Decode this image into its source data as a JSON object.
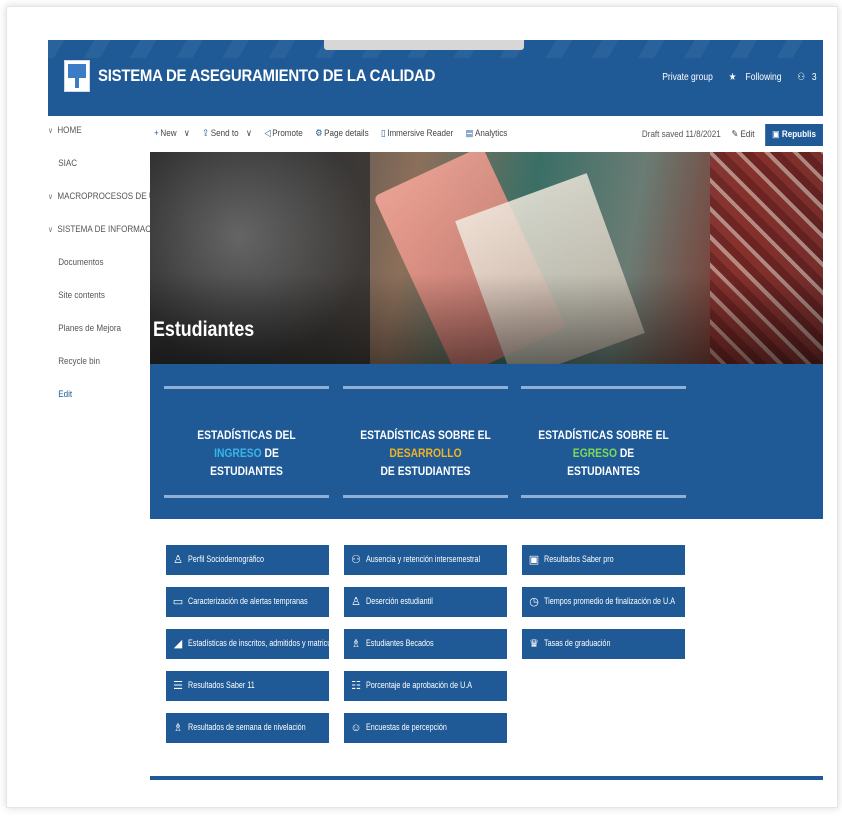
{
  "header": {
    "site_title": "SISTEMA DE ASEGURAMIENTO DE LA CALIDAD",
    "private_group": "Private group",
    "following": "Following",
    "members": "3"
  },
  "nav": {
    "items": [
      {
        "label": "HOME",
        "expandable": true
      },
      {
        "label": "SIAC",
        "expandable": false
      },
      {
        "label": "MACROPROCESOS DE U...",
        "expandable": true
      },
      {
        "label": "SISTEMA DE INFORMACI...",
        "expandable": true
      },
      {
        "label": "Documentos",
        "expandable": false
      },
      {
        "label": "Site contents",
        "expandable": false
      },
      {
        "label": "Planes de Mejora",
        "expandable": false
      },
      {
        "label": "Recycle bin",
        "expandable": false
      },
      {
        "label": "Edit",
        "expandable": false
      }
    ]
  },
  "commandbar": {
    "new": "New",
    "send_to": "Send to",
    "promote": "Promote",
    "page_details": "Page details",
    "immersive_reader": "Immersive Reader",
    "analytics": "Analytics",
    "draft_saved": "Draft saved 11/8/2021",
    "edit": "Edit",
    "republish": "Republis"
  },
  "hero": {
    "title": "Estudiantes"
  },
  "sections": [
    {
      "pre": "ESTADÍSTICAS DEL ",
      "highlight": "INGRESO",
      "post": " DE",
      "line2": "ESTUDIANTES",
      "highlight_color": "#39b4e8"
    },
    {
      "pre": "ESTADÍSTICAS SOBRE EL ",
      "highlight": "DESARROLLO",
      "post": "",
      "line2": "DE ESTUDIANTES",
      "highlight_color": "#f0b323"
    },
    {
      "pre": "ESTADÍSTICAS SOBRE EL ",
      "highlight": "EGRESO",
      "post": " DE",
      "line2": "ESTUDIANTES",
      "highlight_color": "#7ed957"
    }
  ],
  "buttons": {
    "col1": [
      {
        "label": "Perfil Sociodemográfico",
        "icon": "person-icon"
      },
      {
        "label": "Caracterización de alertas tempranas",
        "icon": "id-card-icon"
      },
      {
        "label": "Estadísticas de inscritos, admitidos y matriculados...",
        "icon": "chart-icon"
      },
      {
        "label": "Resultados Saber 11",
        "icon": "document-icon"
      },
      {
        "label": "Resultados de semana de nivelación",
        "icon": "person-chart-icon"
      }
    ],
    "col2": [
      {
        "label": "Ausencia y retención intersemestral",
        "icon": "people-icon"
      },
      {
        "label": "Deserción estudiantil",
        "icon": "person-leave-icon"
      },
      {
        "label": "Estudiantes Becados",
        "icon": "person-award-icon"
      },
      {
        "label": "Porcentaje de aprobación de U.A",
        "icon": "checklist-icon"
      },
      {
        "label": "Encuestas de percepción",
        "icon": "smiley-icon"
      }
    ],
    "col3": [
      {
        "label": "Resultados Saber pro",
        "icon": "report-icon"
      },
      {
        "label": "Tiempos promedio de finalización de U.A",
        "icon": "timer-icon"
      },
      {
        "label": "Tasas de graduación",
        "icon": "graduation-icon"
      }
    ]
  },
  "colors": {
    "primary_blue": "#1f5a96",
    "band_bar": "#8fb0d4"
  }
}
